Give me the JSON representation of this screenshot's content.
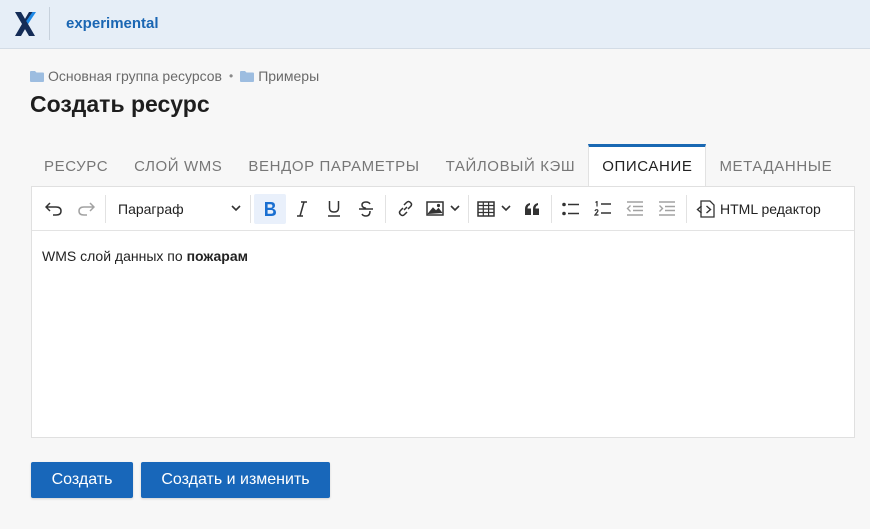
{
  "header": {
    "app_name": "experimental",
    "logo_icon": "x-logo-icon"
  },
  "breadcrumb": {
    "items": [
      "Основная группа ресурсов",
      "Примеры"
    ],
    "separator": "•"
  },
  "page": {
    "title": "Создать ресурс"
  },
  "tabs": [
    {
      "label": "РЕСУРС",
      "active": false
    },
    {
      "label": "СЛОЙ WMS",
      "active": false
    },
    {
      "label": "ВЕНДОР ПАРАМЕТРЫ",
      "active": false
    },
    {
      "label": "ТАЙЛОВЫЙ КЭШ",
      "active": false
    },
    {
      "label": "ОПИСАНИЕ",
      "active": true
    },
    {
      "label": "МЕТАДАННЫЕ",
      "active": false
    }
  ],
  "toolbar": {
    "block_format": "Параграф",
    "html_editor_label": "HTML редактор",
    "bold_active": true
  },
  "editor": {
    "text_plain": "WMS слой данных по ",
    "text_bold": "пожарам"
  },
  "actions": {
    "create": "Создать",
    "create_and_edit": "Создать и изменить"
  },
  "colors": {
    "accent": "#1867ba",
    "header_bg": "#e6eef7",
    "bold_icon": "#1a6fd1"
  }
}
